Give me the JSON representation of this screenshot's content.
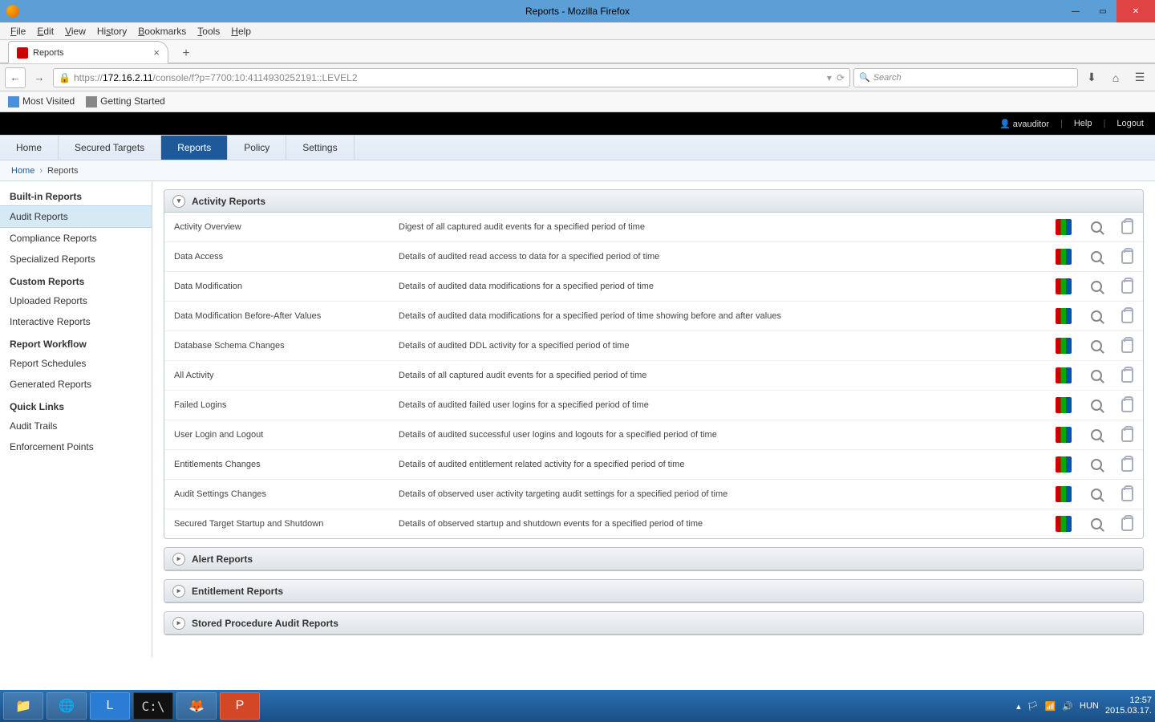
{
  "window": {
    "title": "Reports - Mozilla Firefox"
  },
  "menu": {
    "file": "File",
    "edit": "Edit",
    "view": "View",
    "history": "History",
    "bookmarks": "Bookmarks",
    "tools": "Tools",
    "help": "Help"
  },
  "tab": {
    "title": "Reports"
  },
  "url": {
    "prefix": "https://",
    "host": "172.16.2.11",
    "path": "/console/f?p=7700:10:4114930252191::LEVEL2"
  },
  "search": {
    "placeholder": "Search"
  },
  "bookmarks": {
    "most": "Most Visited",
    "getting": "Getting Started"
  },
  "appbar": {
    "user": "avauditor",
    "help": "Help",
    "logout": "Logout"
  },
  "tabs": {
    "home": "Home",
    "secured": "Secured Targets",
    "reports": "Reports",
    "policy": "Policy",
    "settings": "Settings"
  },
  "crumb": {
    "home": "Home",
    "reports": "Reports"
  },
  "side": {
    "builtin": "Built-in Reports",
    "audit": "Audit Reports",
    "compliance": "Compliance Reports",
    "specialized": "Specialized Reports",
    "custom": "Custom Reports",
    "uploaded": "Uploaded Reports",
    "interactive": "Interactive Reports",
    "workflow": "Report Workflow",
    "schedules": "Report Schedules",
    "generated": "Generated Reports",
    "quick": "Quick Links",
    "trails": "Audit Trails",
    "enforce": "Enforcement Points"
  },
  "sections": {
    "activity": "Activity Reports",
    "alert": "Alert Reports",
    "entitle": "Entitlement Reports",
    "stored": "Stored Procedure Audit Reports"
  },
  "rows": [
    {
      "name": "Activity Overview",
      "desc": "Digest of all captured audit events for a specified period of time"
    },
    {
      "name": "Data Access",
      "desc": "Details of audited read access to data for a specified period of time"
    },
    {
      "name": "Data Modification",
      "desc": "Details of audited data modifications for a specified period of time"
    },
    {
      "name": "Data Modification Before-After Values",
      "desc": "Details of audited data modifications for a specified period of time showing before and after values"
    },
    {
      "name": "Database Schema Changes",
      "desc": "Details of audited DDL activity for a specified period of time"
    },
    {
      "name": "All Activity",
      "desc": "Details of all captured audit events for a specified period of time"
    },
    {
      "name": "Failed Logins",
      "desc": "Details of audited failed user logins for a specified period of time"
    },
    {
      "name": "User Login and Logout",
      "desc": "Details of audited successful user logins and logouts for a specified period of time"
    },
    {
      "name": "Entitlements Changes",
      "desc": "Details of audited entitlement related activity for a specified period of time"
    },
    {
      "name": "Audit Settings Changes",
      "desc": "Details of observed user activity targeting audit settings for a specified period of time"
    },
    {
      "name": "Secured Target Startup and Shutdown",
      "desc": "Details of observed startup and shutdown events for a specified period of time"
    }
  ],
  "tray": {
    "lang": "HUN",
    "time": "12:57",
    "date": "2015.03.17."
  }
}
